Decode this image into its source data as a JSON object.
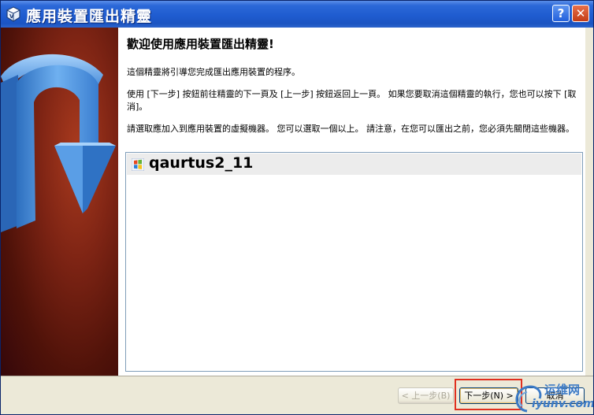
{
  "window": {
    "title": "應用裝置匯出精靈",
    "help_label": "?",
    "close_label": "✕"
  },
  "content": {
    "heading": "歡迎使用應用裝置匯出精靈!",
    "para1": "這個精靈將引導您完成匯出應用裝置的程序。",
    "para2": "使用 [下一步] 按鈕前往精靈的下一頁及 [上一步] 按鈕返回上一頁。 如果您要取消這個精靈的執行，您也可以按下 [取消]。",
    "para3": "請選取應加入到應用裝置的虛擬機器。 您可以選取一個以上。 請注意，在您可以匯出之前，您必須先關閉這些機器。"
  },
  "vm_list": {
    "items": [
      {
        "name": "qaurtus2_11",
        "icon": "windows-xp-icon"
      }
    ]
  },
  "buttons": {
    "back": "< 上一步(B)",
    "next": "下一步(N) >",
    "cancel": "取消"
  },
  "watermark": {
    "line1": "运维网",
    "line2": "iyunv.com"
  },
  "colors": {
    "titlebar": "#1f5cd0",
    "side_panel": "#7e2414",
    "arrow": "#4a8ed8",
    "highlight": "#e03020"
  }
}
